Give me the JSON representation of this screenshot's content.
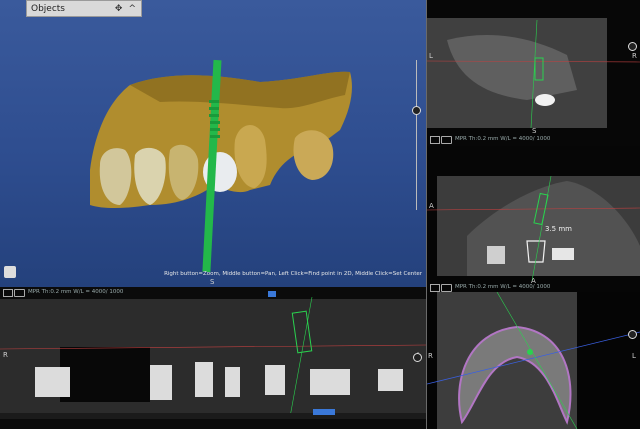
{
  "objects_panel": {
    "title": "Objects",
    "move_icon": "✥",
    "collapse_icon": "^"
  },
  "views": {
    "three_d": {
      "hint": "Right button=Zoom, Middle button=Pan, Left Click=Find point in 2D, Middle Click=Set Center",
      "orientation_bottom": "S"
    },
    "panorama": {
      "status": "MPR  Th:0.2 mm  W/L = 4000/ 1000",
      "label_left": "R",
      "label_right": "L"
    },
    "coronal": {
      "label_left": "L",
      "label_right": "R",
      "label_bottom": "S",
      "status": "MPR  Th:0.2 mm  W/L = 4000/ 1000"
    },
    "sagittal": {
      "label_left": "A",
      "label_bottom": "A",
      "measurement": "3.5 mm",
      "status": "MPR  Th:0.2 mm  W/L = 4000/ 1000"
    },
    "axial": {
      "label_left": "R",
      "label_right": "L"
    }
  }
}
